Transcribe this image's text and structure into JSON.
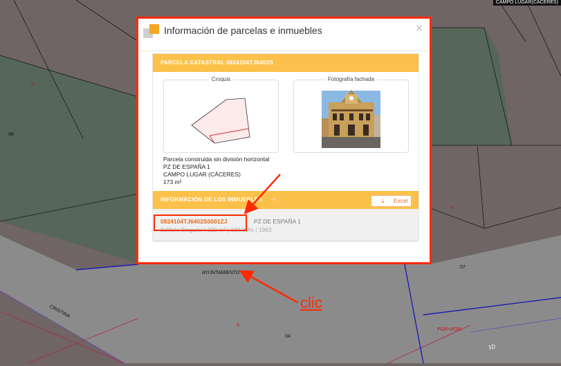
{
  "map": {
    "corner_label": "CAMPO LUGAR(CÁCERES)",
    "labels": {
      "parcel_08": "08",
      "parcel_07": "07",
      "parcel_04": "04",
      "street_cristina": "CRISTINA",
      "street_ayuntamiento": "AYUNTAMIENTO",
      "label_ii_left": "II",
      "label_ii_right": "II",
      "label_ii_bottom": "II",
      "label_por_por": "POR+POR",
      "label_1d": "1D"
    },
    "colors": {
      "base": "#6f6565",
      "green_parcel": "#566658",
      "road": "#8b8b8b",
      "highlight": "#ff2a00"
    }
  },
  "dialog": {
    "title": "Información de parcelas e inmuebles",
    "close_icon": "×",
    "parcel_header": "PARCELA CATASTRAL 0824104TJ6402S",
    "croquis_label": "Croquis",
    "photo_label": "Fotografía fachada",
    "parcel_info": [
      "Parcela construida sin división horizontal",
      "PZ DE ESPAÑA 1",
      "CAMPO LUGAR (CÁCERES)",
      "173 m²"
    ],
    "properties_header": "INFORMACIÓN DE LOS INMUEBLES",
    "excel_button": "Excel",
    "properties": [
      {
        "ref": "0824104TJ6402S0001ZJ",
        "address": "PZ DE ESPAÑA 1",
        "meta": "Edificio Singular | 320 m² | 100,00% | 1983"
      }
    ]
  },
  "annotation": {
    "clic_text": "clic"
  }
}
